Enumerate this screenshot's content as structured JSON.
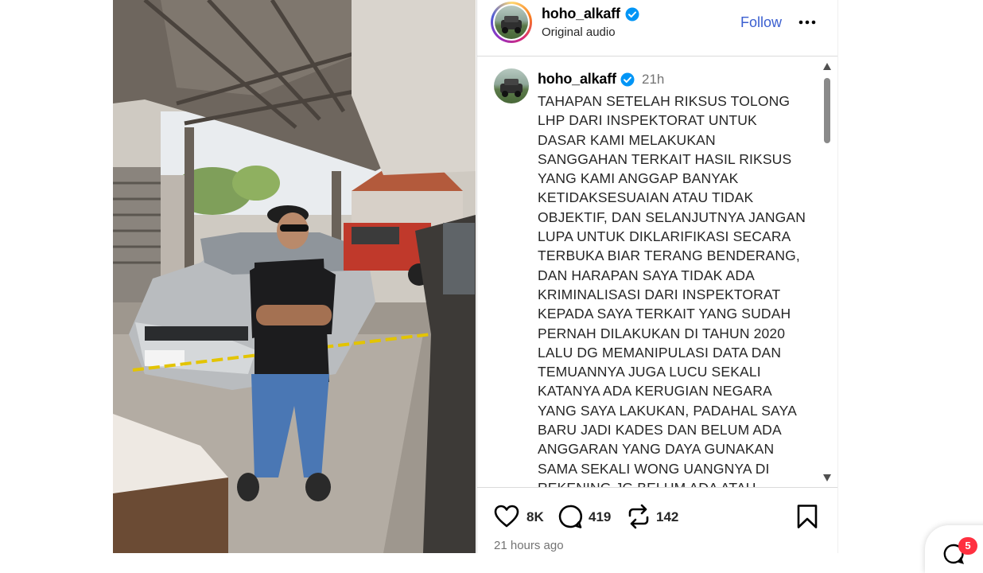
{
  "post": {
    "author": "hoho_alkaff",
    "audio": "Original audio",
    "follow_label": "Follow",
    "caption": {
      "author": "hoho_alkaff",
      "time": "21h",
      "text": "TAHAPAN SETELAH RIKSUS TOLONG\nLHP DARI INSPEKTORAT  UNTUK\nDASAR KAMI MELAKUKAN\nSANGGAHAN TERKAIT HASIL RIKSUS\nYANG KAMI ANGGAP BANYAK\nKETIDAKSESUAIAN ATAU TIDAK\nOBJEKTIF, DAN SELANJUTNYA JANGAN\nLUPA UNTUK DIKLARIFIKASI SECARA\nTERBUKA BIAR TERANG BENDERANG,\nDAN HARAPAN SAYA TIDAK ADA\nKRIMINALISASI DARI INSPEKTORAT\nKEPADA SAYA TERKAIT YANG SUDAH\nPERNAH DILAKUKAN DI TAHUN 2020\nLALU DG MEMANIPULASI DATA DAN\nTEMUANNYA JUGA LUCU SEKALI\nKATANYA ADA KERUGIAN NEGARA\nYANG SAYA LAKUKAN, PADAHAL SAYA\nBARU JADI KADES DAN BELUM ADA\nANGGARAN YANG DAYA GUNAKAN\nSAMA SEKALI WONG UANGNYA DI\nREKENING JG BELUM ADA ATAU"
    },
    "stats": {
      "likes": "8K",
      "comments": "419",
      "reposts": "142"
    },
    "posted_ago": "21 hours ago"
  },
  "messages_badge": "5",
  "colors": {
    "follow": "#3b5fd0",
    "verified": "#0095f6",
    "badge": "#ff3040"
  },
  "icons": [
    "verified-badge-icon",
    "more-icon",
    "heart-icon",
    "comment-icon",
    "repost-icon",
    "bookmark-icon",
    "scroll-up-icon",
    "scroll-down-icon",
    "messages-icon"
  ]
}
